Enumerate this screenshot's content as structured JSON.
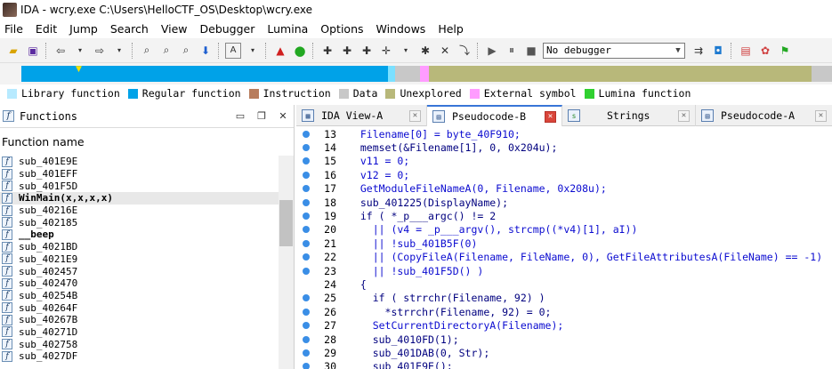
{
  "window": {
    "title": "IDA - wcry.exe C:\\Users\\HelloCTF_OS\\Desktop\\wcry.exe"
  },
  "menu": [
    "File",
    "Edit",
    "Jump",
    "Search",
    "View",
    "Debugger",
    "Lumina",
    "Options",
    "Windows",
    "Help"
  ],
  "toolbar": {
    "debugger_select": "No debugger"
  },
  "navband": {
    "segments": [
      {
        "color": "#00a2e8",
        "from": 0.026,
        "to": 0.466
      },
      {
        "color": "#7be0ff",
        "from": 0.466,
        "to": 0.475
      },
      {
        "color": "#c8c8c8",
        "from": 0.475,
        "to": 0.505
      },
      {
        "color": "#ff9cff",
        "from": 0.505,
        "to": 0.515
      },
      {
        "color": "#b8b87a",
        "from": 0.515,
        "to": 0.975
      },
      {
        "color": "#c8c8c8",
        "from": 0.975,
        "to": 1.0
      }
    ]
  },
  "legend": [
    {
      "label": "Library function",
      "color": "#b7eaff"
    },
    {
      "label": "Regular function",
      "color": "#00a2e8"
    },
    {
      "label": "Instruction",
      "color": "#b87c5c"
    },
    {
      "label": "Data",
      "color": "#c8c8c8"
    },
    {
      "label": "Unexplored",
      "color": "#b8b87a"
    },
    {
      "label": "External symbol",
      "color": "#ff9cff"
    },
    {
      "label": "Lumina function",
      "color": "#30d030"
    }
  ],
  "functions_panel": {
    "title": "Functions",
    "column_header": "Function name",
    "items": [
      {
        "name": "sub_401E9E",
        "bold": false,
        "selected": false
      },
      {
        "name": "sub_401EFF",
        "bold": false,
        "selected": false
      },
      {
        "name": "sub_401F5D",
        "bold": false,
        "selected": false
      },
      {
        "name": "WinMain(x,x,x,x)",
        "bold": true,
        "selected": true
      },
      {
        "name": "sub_40216E",
        "bold": false,
        "selected": false
      },
      {
        "name": "sub_402185",
        "bold": false,
        "selected": false
      },
      {
        "name": "__beep",
        "bold": true,
        "selected": false
      },
      {
        "name": "sub_4021BD",
        "bold": false,
        "selected": false
      },
      {
        "name": "sub_4021E9",
        "bold": false,
        "selected": false
      },
      {
        "name": "sub_402457",
        "bold": false,
        "selected": false
      },
      {
        "name": "sub_402470",
        "bold": false,
        "selected": false
      },
      {
        "name": "sub_40254B",
        "bold": false,
        "selected": false
      },
      {
        "name": "sub_40264F",
        "bold": false,
        "selected": false
      },
      {
        "name": "sub_40267B",
        "bold": false,
        "selected": false
      },
      {
        "name": "sub_40271D",
        "bold": false,
        "selected": false
      },
      {
        "name": "sub_402758",
        "bold": false,
        "selected": false
      },
      {
        "name": "sub_4027DF",
        "bold": false,
        "selected": false
      }
    ]
  },
  "tabs": [
    {
      "label": "IDA View-A",
      "active": false
    },
    {
      "label": "Pseudocode-B",
      "active": true
    },
    {
      "label": "Strings",
      "active": false
    },
    {
      "label": "Pseudocode-A",
      "active": false
    }
  ],
  "code": [
    {
      "no": "13",
      "text": "  Filename[0] = byte_40F910;"
    },
    {
      "no": "14",
      "text": "  memset(&Filename[1], 0, 0x204u);"
    },
    {
      "no": "15",
      "text": "  v11 = 0;"
    },
    {
      "no": "16",
      "text": "  v12 = 0;"
    },
    {
      "no": "17",
      "text": "  GetModuleFileNameA(0, Filename, 0x208u);"
    },
    {
      "no": "18",
      "text": "  sub_401225(DisplayName);"
    },
    {
      "no": "19",
      "text": "  if ( *_p___argc() != 2"
    },
    {
      "no": "20",
      "text": "    || (v4 = _p___argv(), strcmp((*v4)[1], aI))"
    },
    {
      "no": "21",
      "text": "    || !sub_401B5F(0)"
    },
    {
      "no": "22",
      "text": "    || (CopyFileA(Filename, FileName, 0), GetFileAttributesA(FileName) == -1)"
    },
    {
      "no": "23",
      "text": "    || !sub_401F5D() )"
    },
    {
      "no": "24",
      "text": "  {"
    },
    {
      "no": "25",
      "text": "    if ( strrchr(Filename, 92) )"
    },
    {
      "no": "26",
      "text": "      *strrchr(Filename, 92) = 0;"
    },
    {
      "no": "27",
      "text": "    SetCurrentDirectoryA(Filename);"
    },
    {
      "no": "28",
      "text": "    sub_4010FD(1);"
    },
    {
      "no": "29",
      "text": "    sub_401DAB(0, Str);"
    },
    {
      "no": "30",
      "text": "    sub_401E9E();"
    }
  ]
}
